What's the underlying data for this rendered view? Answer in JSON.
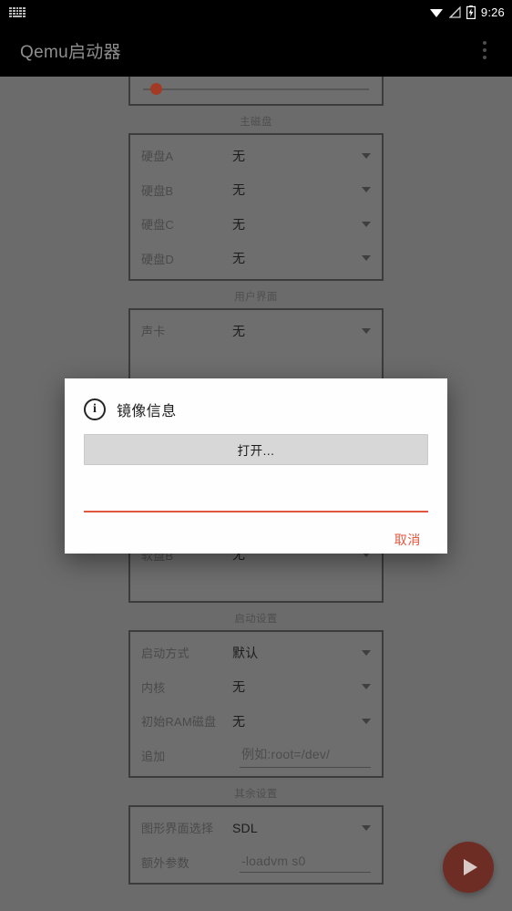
{
  "statusbar": {
    "time": "9:26",
    "icons": [
      "keyboard-icon",
      "wifi-icon",
      "signal-off-icon",
      "battery-charging-icon"
    ]
  },
  "appbar": {
    "title": "Qemu启动器",
    "overflow_icon": "more-vert-icon"
  },
  "colors": {
    "accent": "#e2573f",
    "fab": "#6e2d24",
    "scrim_background": "#6b6b6b",
    "group_border": "#3c3c3c",
    "dialog_background": "#fefefe"
  },
  "content": {
    "slider": {
      "name": "memory-slider",
      "value_position": "8"
    },
    "groups": [
      {
        "title": "主磁盘",
        "rows": [
          {
            "label": "硬盘A",
            "value": "无",
            "type": "dropdown"
          },
          {
            "label": "硬盘B",
            "value": "无",
            "type": "dropdown"
          },
          {
            "label": "硬盘C",
            "value": "无",
            "type": "dropdown"
          },
          {
            "label": "硬盘D",
            "value": "无",
            "type": "dropdown"
          }
        ]
      },
      {
        "title": "用户界面",
        "rows": [
          {
            "label": "声卡",
            "value": "无",
            "type": "dropdown"
          }
        ]
      },
      {
        "title": "",
        "rows": [
          {
            "label": "软盘B",
            "value": "无",
            "type": "dropdown"
          }
        ]
      },
      {
        "title": "启动设置",
        "rows": [
          {
            "label": "启动方式",
            "value": "默认",
            "type": "dropdown"
          },
          {
            "label": "内核",
            "value": "无",
            "type": "dropdown"
          },
          {
            "label": "初始RAM磁盘",
            "value": "无",
            "type": "dropdown"
          },
          {
            "label": "追加",
            "value": "",
            "placeholder": "例如:root=/dev/",
            "type": "input"
          }
        ]
      },
      {
        "title": "其余设置",
        "rows": [
          {
            "label": "图形界面选择",
            "value": "SDL",
            "type": "dropdown"
          },
          {
            "label": "额外参数",
            "value": "-loadvm s0",
            "type": "input"
          }
        ]
      }
    ],
    "fab": {
      "icon": "play-icon",
      "label": ""
    }
  },
  "dialog": {
    "icon": "info-icon",
    "icon_glyph": "i",
    "title": "镜像信息",
    "open_button": "打开...",
    "field_value": "",
    "cancel_button": "取消"
  }
}
